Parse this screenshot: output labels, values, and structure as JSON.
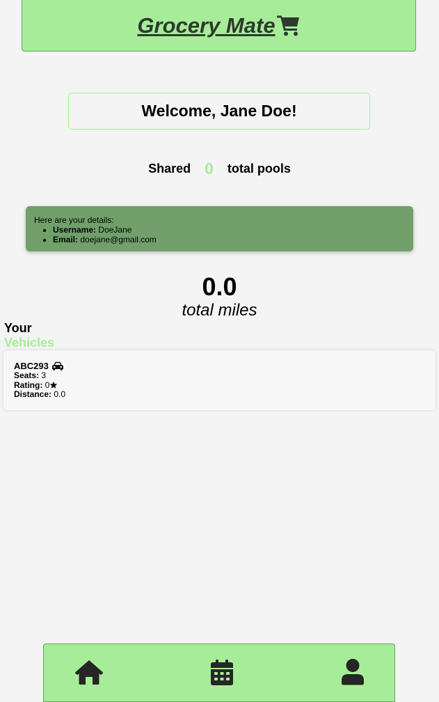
{
  "header": {
    "title": "Grocery Mate",
    "icon": "shopping-cart-icon"
  },
  "welcome": {
    "text": "Welcome, Jane Doe!"
  },
  "pools": {
    "prefix": "Shared",
    "count": "0",
    "suffix": "total pools"
  },
  "details": {
    "intro": "Here are your details:",
    "username_label": "Username:",
    "username": "DoeJane",
    "email_label": "Email:",
    "email": "doejane@gmail.com"
  },
  "miles": {
    "value": "0.0",
    "label": "total miles"
  },
  "vehicles": {
    "heading_your": "Your",
    "heading_vehicles": "Vehicles",
    "items": [
      {
        "plate": "ABC293",
        "icon": "car-icon",
        "seats_label": "Seats:",
        "seats": "3",
        "rating_label": "Rating:",
        "rating": "0",
        "rating_icon": "star-icon",
        "distance_label": "Distance:",
        "distance": "0.0"
      }
    ]
  },
  "nav": {
    "items": [
      {
        "icon": "home-icon"
      },
      {
        "icon": "calendar-icon"
      },
      {
        "icon": "user-icon"
      }
    ]
  },
  "colors": {
    "accent": "#a7ed99",
    "details_bg": "#71a06b",
    "page_bg": "#f4f4f4",
    "brand_text": "#2d3a2d"
  }
}
